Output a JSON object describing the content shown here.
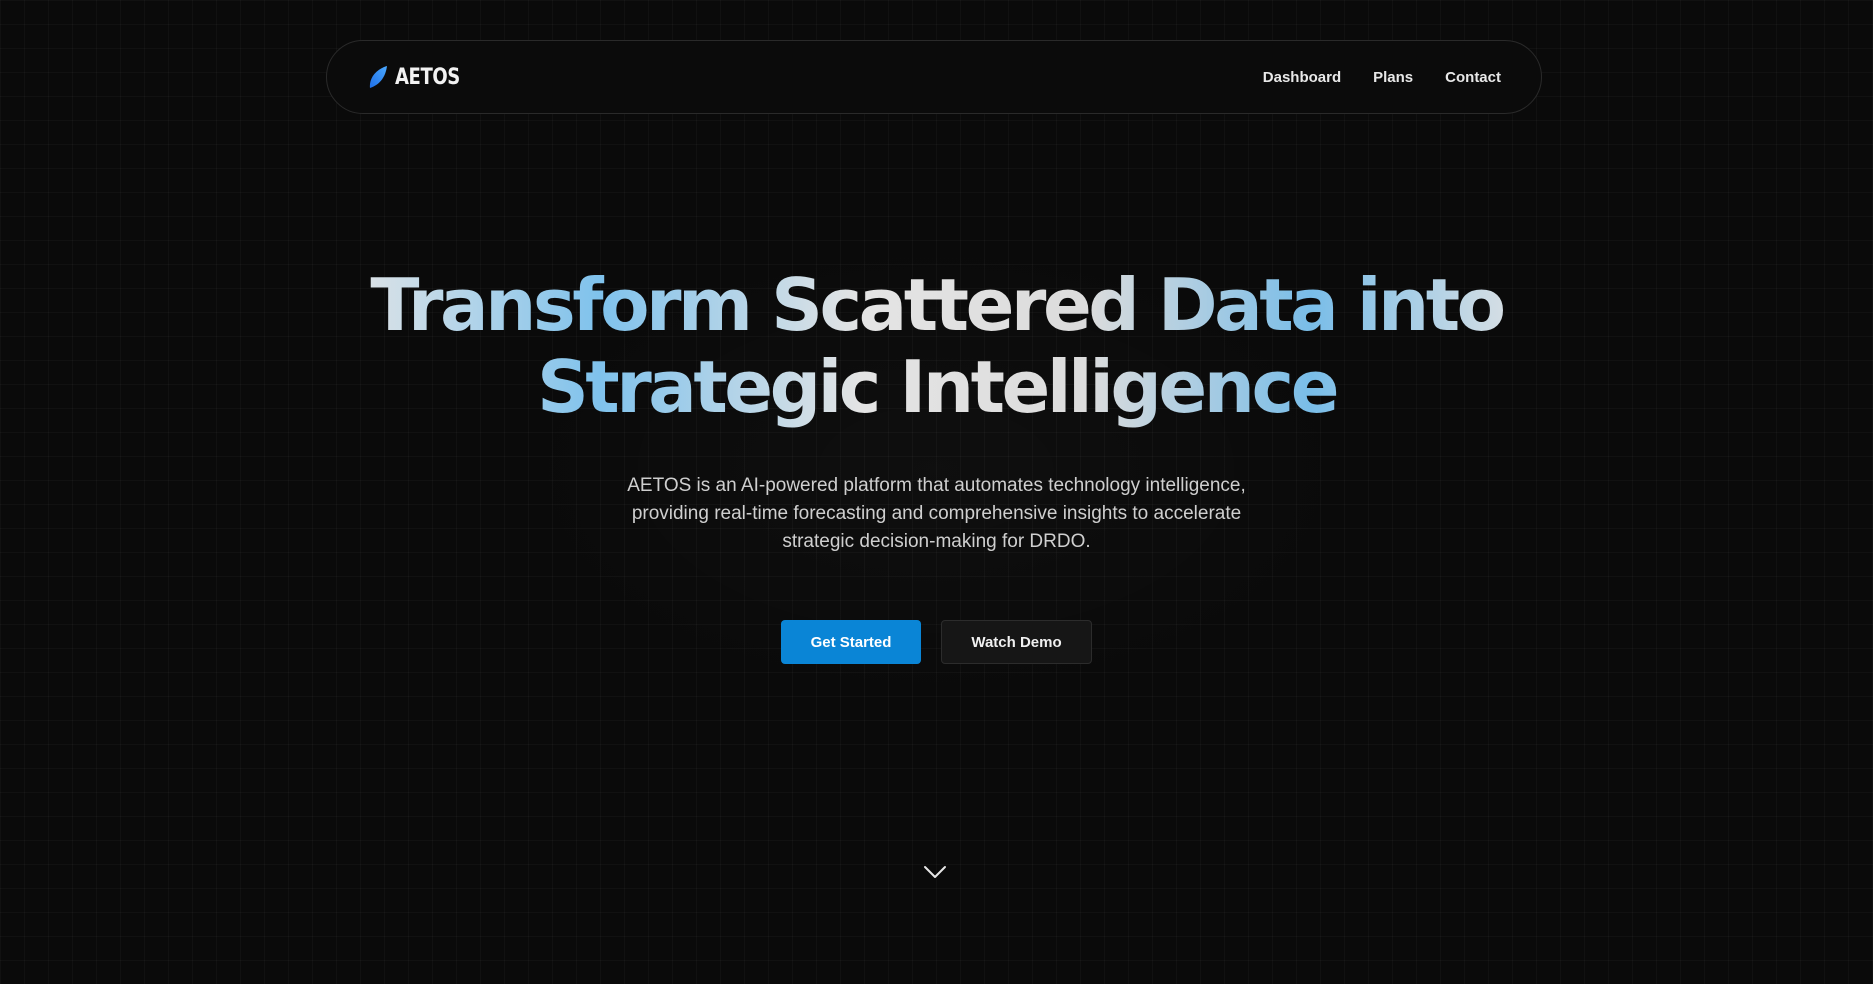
{
  "nav": {
    "brand": "AETOS",
    "links": [
      "Dashboard",
      "Plans",
      "Contact"
    ]
  },
  "hero": {
    "title_line1_words": [
      "Transform",
      "Scattered",
      "Data",
      "into"
    ],
    "title_line2_words": [
      "Strategic",
      "Intelligence"
    ],
    "subtitle": "AETOS is an AI-powered platform that automates technology intelligence, providing real-time forecasting and comprehensive insights to accelerate strategic decision-making for DRDO.",
    "primary_cta": "Get Started",
    "secondary_cta": "Watch Demo"
  },
  "icons": {
    "logo": "feather-logo-icon",
    "scroll": "chevron-down-icon"
  },
  "colors": {
    "background": "#0a0a0a",
    "accent": "#0a85d6",
    "logo_blue": "#2f8cff",
    "gradient_blue": "#7fc2ec"
  }
}
